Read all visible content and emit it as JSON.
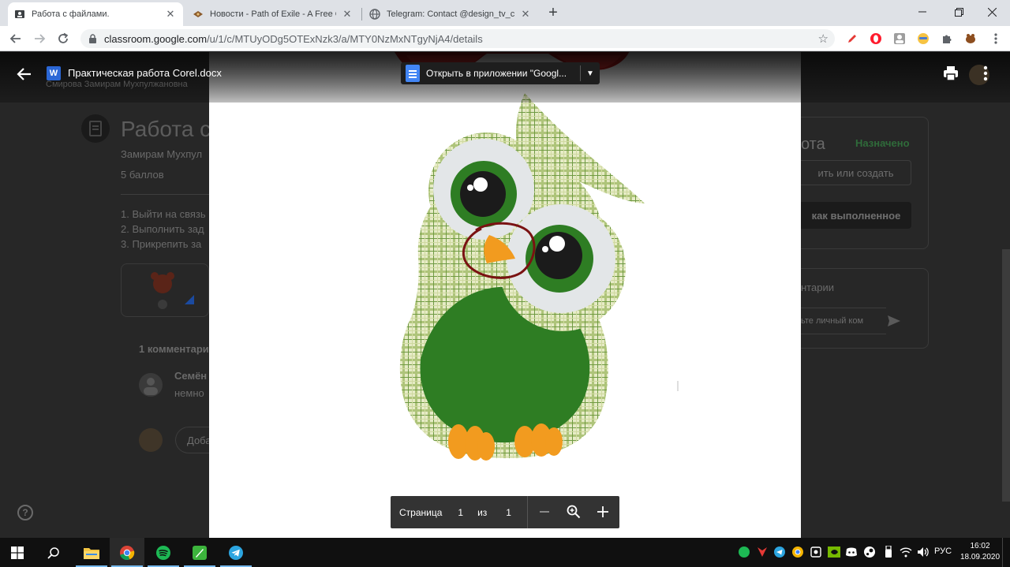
{
  "browser": {
    "tabs": [
      {
        "title": "Работа с файлами.",
        "icon": "classroom-icon",
        "active": true
      },
      {
        "title": "Новости - Path of Exile - A Free Onl",
        "icon": "poe-icon",
        "active": false
      },
      {
        "title": "Telegram: Contact @design_tv_chat",
        "icon": "globe-icon",
        "active": false
      }
    ],
    "new_tab": "+",
    "url_host": "classroom.google.com",
    "url_path": "/u/1/c/MTUyODg5OTExNzk3/a/MTY0NzMxNTgyNjA4/details"
  },
  "background_page": {
    "assignment_title": "Работа с",
    "author": "Замирам Мухпул",
    "points": "5 баллов",
    "steps": [
      "1. Выйти на связь",
      "2. Выполнить зад",
      "3. Прикрепить за"
    ],
    "comments_header": "1 комментари",
    "comment_author": "Семён",
    "comment_text": "немно",
    "comment_input": "Доба",
    "work_heading": "ота",
    "status": "Назначено",
    "add_create": "ить или создать",
    "mark_done": "как выполненное",
    "private_comments": "нтарии",
    "private_input": "ьте личный ком"
  },
  "viewer": {
    "filename": "Практическая работа Corel.docx",
    "owner": "Смирова Замирам Мухпулжановна",
    "open_with": "Открыть в приложении \"Googl...",
    "doc_icon_letter": "W"
  },
  "page_control": {
    "label": "Страница",
    "current": "1",
    "of": "из",
    "total": "1"
  },
  "taskbar": {
    "language": "РУС",
    "time": "16:02",
    "date": "18.09.2020"
  }
}
